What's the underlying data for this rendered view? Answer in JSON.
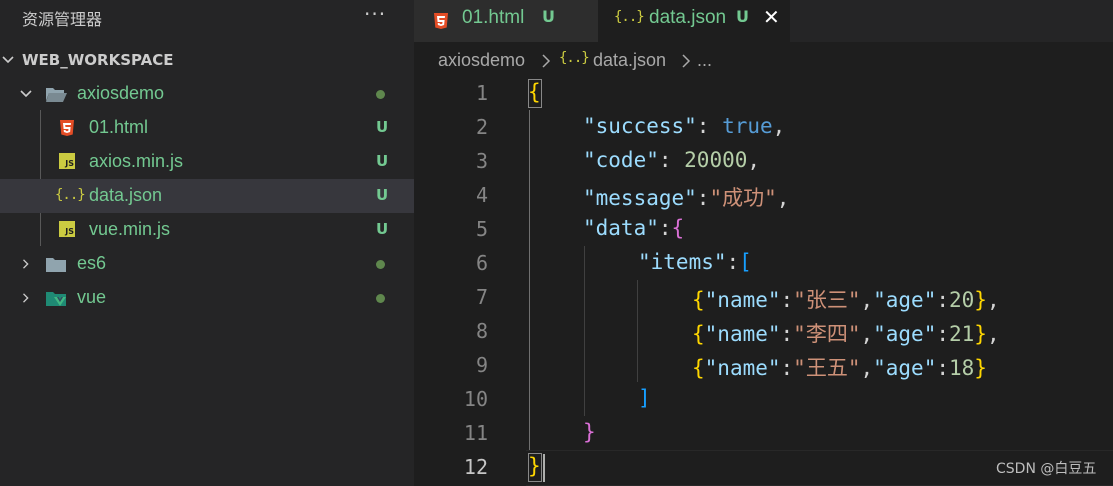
{
  "explorer": {
    "title": "资源管理器",
    "more": "···",
    "workspace": "WEB_WORKSPACE",
    "tree": [
      {
        "name": "axiosdemo",
        "type": "folder-open",
        "status": "dot"
      },
      {
        "name": "01.html",
        "type": "html",
        "status": "U"
      },
      {
        "name": "axios.min.js",
        "type": "js",
        "status": "U"
      },
      {
        "name": "data.json",
        "type": "json",
        "status": "U"
      },
      {
        "name": "vue.min.js",
        "type": "js",
        "status": "U"
      },
      {
        "name": "es6",
        "type": "folder",
        "status": "dot"
      },
      {
        "name": "vue",
        "type": "vue-folder",
        "status": "dot"
      }
    ]
  },
  "tabs": [
    {
      "label": "01.html",
      "status": "U"
    },
    {
      "label": "data.json",
      "status": "U",
      "close": "✕"
    }
  ],
  "breadcrumb": {
    "items": [
      "axiosdemo",
      "data.json",
      "..."
    ],
    "json_icon": "{..}"
  },
  "icons": {
    "js": "JS",
    "json": "{..}"
  },
  "editor": {
    "line_numbers": [
      "1",
      "2",
      "3",
      "4",
      "5",
      "6",
      "7",
      "8",
      "9",
      "10",
      "11",
      "12"
    ],
    "lines": [
      "{",
      "\"success\": true,",
      "\"code\": 20000,",
      "\"message\":\"成功\",",
      "\"data\":{",
      "\"items\":[",
      "{\"name\":\"张三\",\"age\":20},",
      "{\"name\":\"李四\",\"age\":21},",
      "{\"name\":\"王五\",\"age\":18}",
      "]",
      "}",
      "}"
    ],
    "tokens": {
      "success_key": "\"success\"",
      "true_val": "true",
      "code_key": "\"code\"",
      "code_val": "20000",
      "message_key": "\"message\"",
      "message_val": "\"成功\"",
      "data_key": "\"data\"",
      "items_key": "\"items\"",
      "name_key": "\"name\"",
      "age_key": "\"age\"",
      "names": [
        "\"张三\"",
        "\"李四\"",
        "\"王五\""
      ],
      "ages": [
        "20",
        "21",
        "18"
      ]
    }
  },
  "watermark": "CSDN @白豆五",
  "colors": {
    "untracked": "#73c991",
    "js": "#cbcb41",
    "html": "#e44d26",
    "folder": "#90a4ae",
    "vue": "#41b883"
  }
}
